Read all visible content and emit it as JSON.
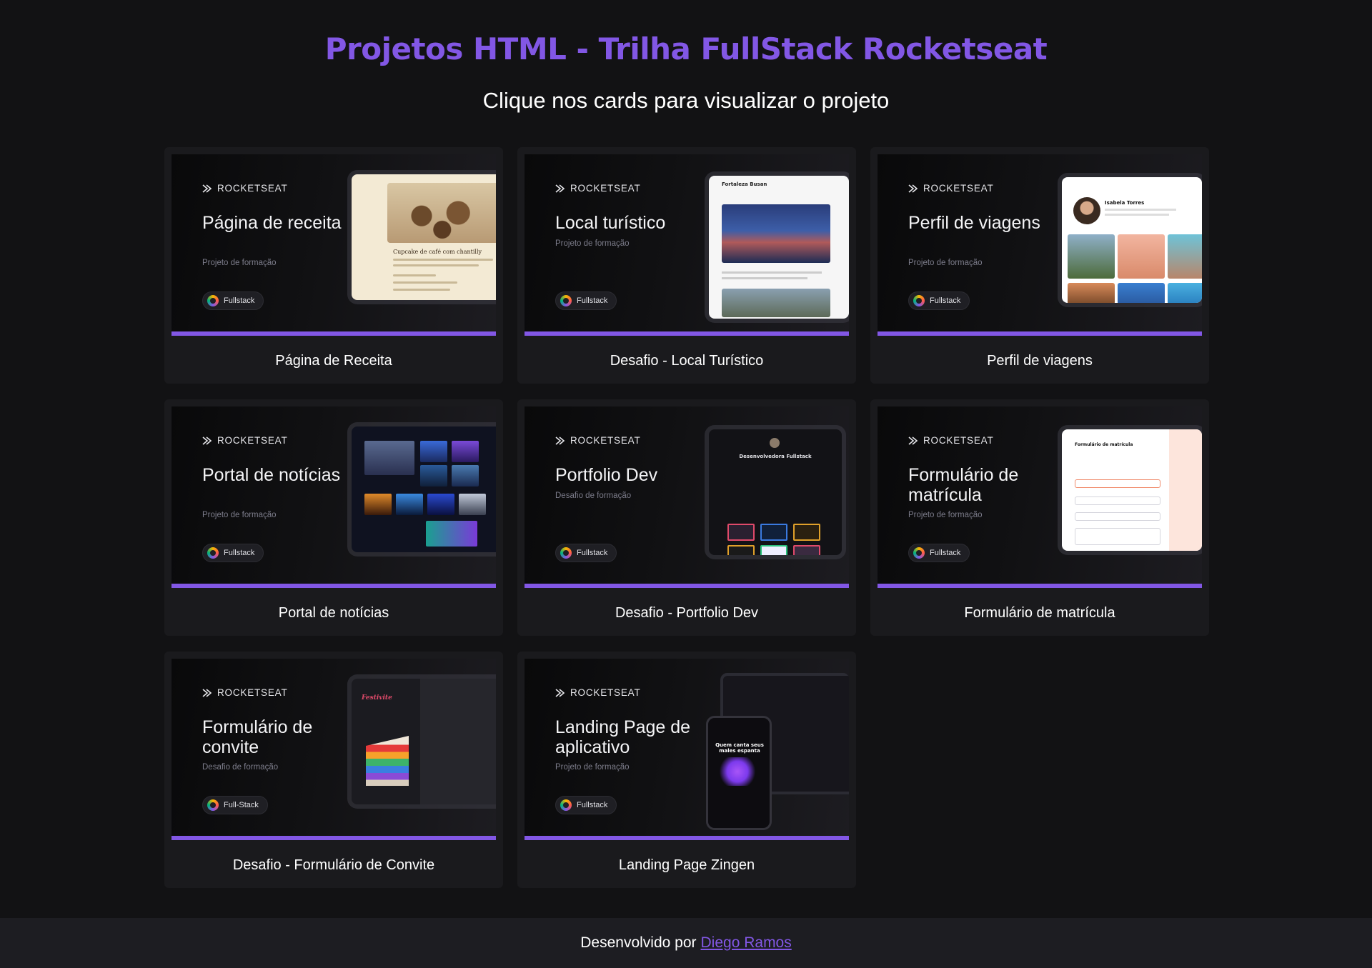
{
  "header": {
    "title": "Projetos HTML - Trilha FullStack Rocketseat",
    "subtitle": "Clique nos cards para visualizar o projeto"
  },
  "brand": {
    "name": "ROCKETSEAT",
    "accent": "#8257e5"
  },
  "cards": [
    {
      "thumb_title": "Página de receita",
      "thumb_sub": "Projeto de formação",
      "pill": "Fullstack",
      "label": "Página de Receita"
    },
    {
      "thumb_title": "Local turístico",
      "thumb_sub": "Projeto de formação",
      "pill": "Fullstack",
      "label": "Desafio - Local Turístico"
    },
    {
      "thumb_title": "Perfil de viagens",
      "thumb_sub": "Projeto de formação",
      "pill": "Fullstack",
      "label": "Perfil de viagens"
    },
    {
      "thumb_title": "Portal de notícias",
      "thumb_sub": "Projeto de formação",
      "pill": "Fullstack",
      "label": "Portal de notícias"
    },
    {
      "thumb_title": "Portfolio Dev",
      "thumb_sub": "Desafio de formação",
      "pill": "Fullstack",
      "label": "Desafio - Portfolio Dev"
    },
    {
      "thumb_title": "Formulário de matrícula",
      "thumb_sub": "Projeto de formação",
      "pill": "Fullstack",
      "label": "Formulário de matrícula"
    },
    {
      "thumb_title": "Formulário de convite",
      "thumb_sub": "Desafio de formação",
      "pill": "Full-Stack",
      "label": "Desafio - Formulário de Convite"
    },
    {
      "thumb_title": "Landing Page de aplicativo",
      "thumb_sub": "Projeto de formação",
      "pill": "Fullstack",
      "label": "Landing Page Zingen"
    }
  ],
  "previews": {
    "recipe_title": "Cupcake de café com chantilly",
    "city_title": "Fortaleza Busan",
    "travel_name": "Isabela Torres",
    "dev_title": "Desenvolvedora Fullstack",
    "form_title": "Formulário de matrícula",
    "invite_title": "Festivite",
    "app_headline": "Quem canta seus males espanta"
  },
  "footer": {
    "prefix": "Desenvolvido por",
    "author_link": "Diego Ramos"
  }
}
